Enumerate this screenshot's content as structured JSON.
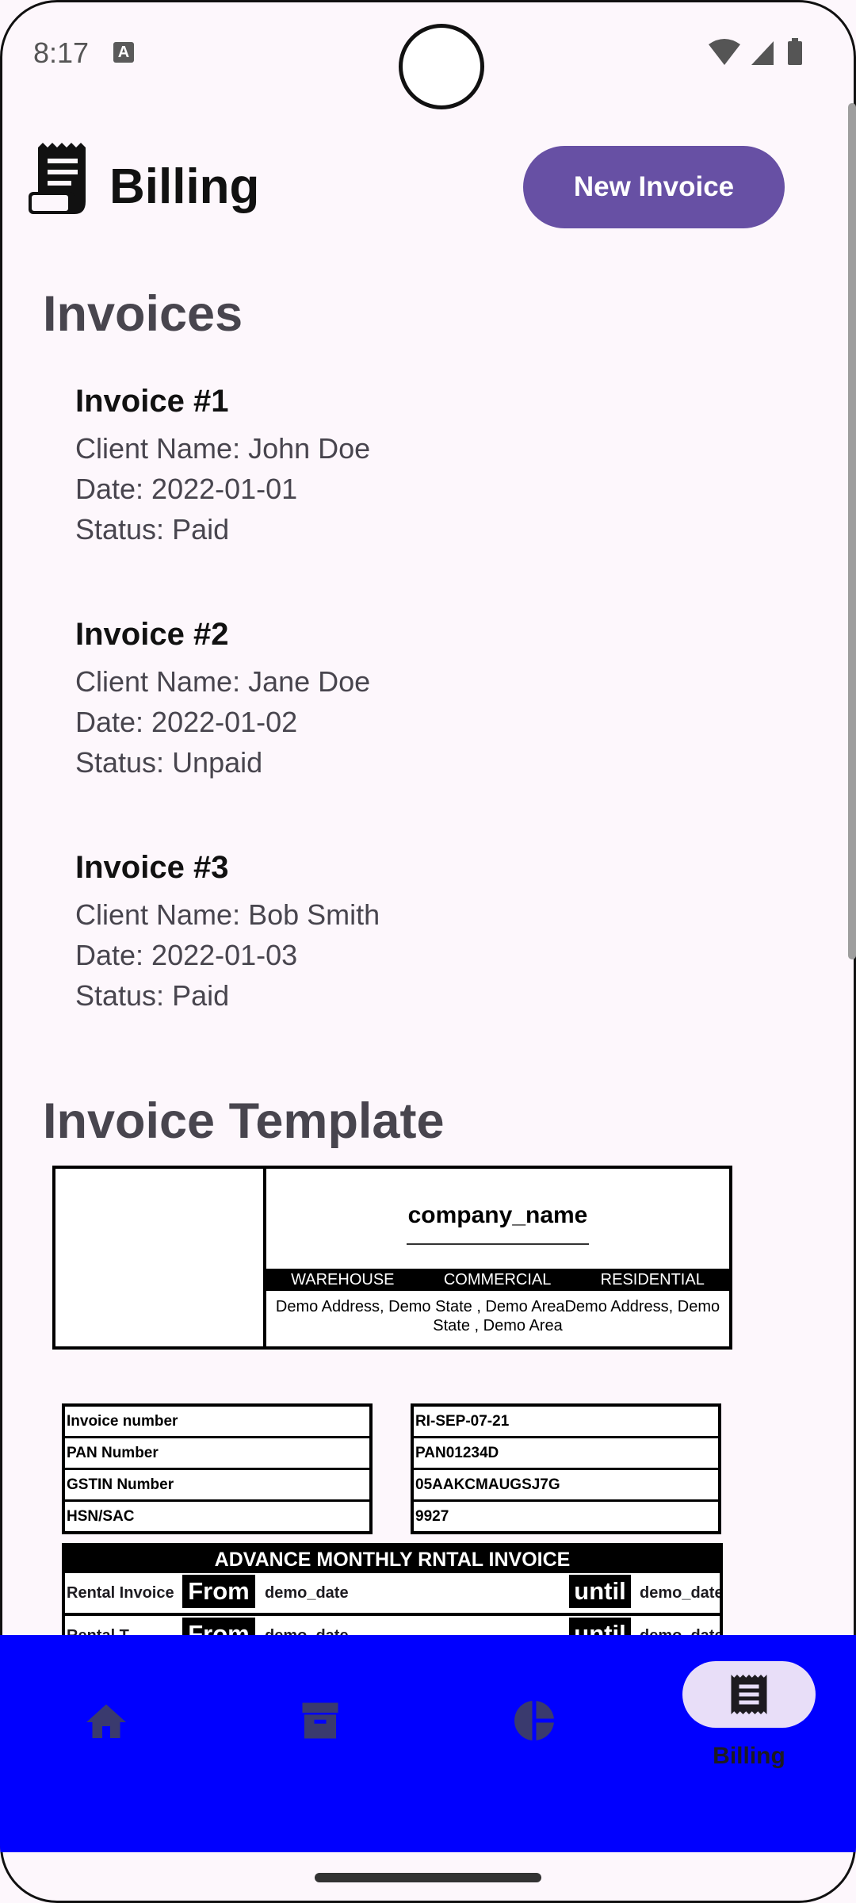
{
  "status_bar": {
    "time": "8:17",
    "notification_icon": "A"
  },
  "header": {
    "title": "Billing",
    "new_invoice_label": "New Invoice"
  },
  "invoices_section": {
    "title": "Invoices"
  },
  "invoices": [
    {
      "title": "Invoice #1",
      "client": "Client Name: John Doe",
      "date": "Date: 2022-01-01",
      "status": "Status: Paid"
    },
    {
      "title": "Invoice #2",
      "client": "Client Name: Jane Doe",
      "date": "Date: 2022-01-02",
      "status": "Status: Unpaid"
    },
    {
      "title": "Invoice #3",
      "client": "Client Name: Bob Smith",
      "date": "Date: 2022-01-03",
      "status": "Status: Paid"
    }
  ],
  "template": {
    "title": "Invoice Template",
    "company_name": "company_name",
    "categories": [
      "WAREHOUSE",
      "COMMERCIAL",
      "RESIDENTIAL"
    ],
    "address": "Demo Address, Demo State , Demo AreaDemo Address, Demo State , Demo Area",
    "labels": [
      "Invoice number",
      "PAN Number",
      "GSTIN Number",
      "HSN/SAC"
    ],
    "values": [
      "RI-SEP-07-21",
      "PAN01234D",
      "05AAKCMAUGSJ7G",
      "9927"
    ],
    "rental_heading": "ADVANCE MONTHLY RNTAL INVOICE",
    "rental_row": {
      "label": "Rental Invoice",
      "from": "From",
      "from_date": "demo_date",
      "until": "until",
      "until_date": "demo_date"
    },
    "rental_row2": {
      "label": "Rental T",
      "from": "From",
      "from_date": "demo_date",
      "until": "until",
      "until_date": "demo_date"
    }
  },
  "bottom_nav": {
    "items": [
      {
        "icon": "home-icon"
      },
      {
        "icon": "archive-icon"
      },
      {
        "icon": "pie-chart-icon"
      },
      {
        "icon": "receipt-icon",
        "label": "Billing",
        "selected": true
      }
    ],
    "background": "#0000ff"
  },
  "colors": {
    "primary": "#6750a4",
    "background": "#fdf7fc",
    "nav_selected_pill": "#e8def8"
  }
}
